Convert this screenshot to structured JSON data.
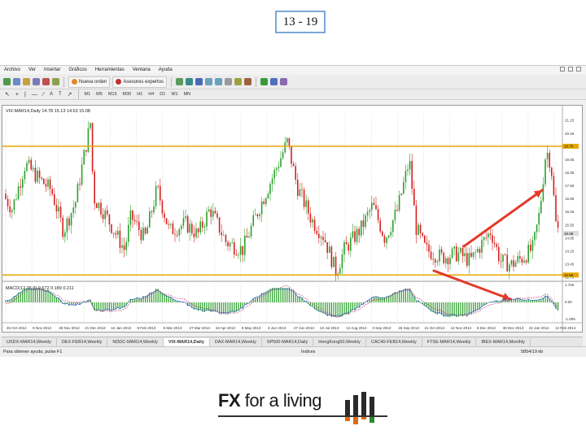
{
  "slide": {
    "number": "13 - 19"
  },
  "menu": [
    "Archivo",
    "Ver",
    "Insertar",
    "Gráficos",
    "Herramientas",
    "Ventana",
    "Ayuda"
  ],
  "toolbar": {
    "new_order": "Nueva orden",
    "expert_advisors": "Asesores expertos"
  },
  "timeframes": [
    "M1",
    "M5",
    "M15",
    "M30",
    "H1",
    "H4",
    "D1",
    "W1",
    "MN"
  ],
  "chart": {
    "header": "VIX-MAR14,Daily  14.78 15.13 14.63 15.08",
    "osc_header": "MACD(12,26,9)  0.672 0.189 0.211",
    "price_axis": [
      "21.15",
      "20.45",
      "19.75",
      "19.05",
      "18.35",
      "17.65",
      "16.95",
      "16.25",
      "15.55",
      "14.85",
      "14.15",
      "13.45",
      "12.75"
    ],
    "price_tag_upper": "19.75",
    "price_tag_current": "15.08",
    "price_tag_lower": "12.65",
    "osc_axis": [
      "1.726",
      "0.00",
      "-1.005"
    ],
    "dates": [
      "25 Oct 2012",
      "8 Nov 2012",
      "28 Nov 2012",
      "21 Dec 2012",
      "16 Jan 2013",
      "8 Feb 2013",
      "5 Mar 2013",
      "27 Mar 2013",
      "18 Apr 2013",
      "9 May 2013",
      "3 Jun 2013",
      "27 Jun 2013",
      "22 Jul 2013",
      "12 Aug 2013",
      "3 Sep 2013",
      "26 Sep 2013",
      "21 Oct 2013",
      "12 Nov 2013",
      "5 Dec 2013",
      "30 Dec 2013",
      "22 Jan 2014",
      "12 Feb 2014"
    ],
    "colors": {
      "bull": "#2ca02c",
      "bear": "#d42020",
      "level": "#e6a700",
      "arrow": "#e33a2a",
      "macd": "#1f4fd6",
      "signal": "#c03060"
    }
  },
  "tabs": [
    {
      "label": "USDX-MAR14,Weekly"
    },
    {
      "label": "DEX-FEB14,Weekly"
    },
    {
      "label": "NDDC-MAR14,Weekly"
    },
    {
      "label": "VIX-MAR14,Daily",
      "active": true
    },
    {
      "label": "DAX-MAR14,Weekly"
    },
    {
      "label": "SP500-MAR14,Daily"
    },
    {
      "label": "HongKong50,Weekly"
    },
    {
      "label": "CAC40-FEB14,Weekly"
    },
    {
      "label": "FTSE-MAR14,Weekly"
    },
    {
      "label": "IBEX-MAR14,Monthly"
    }
  ],
  "status": {
    "help": "Para obtener ayuda, pulse F1",
    "profile": "Índices",
    "traffic": "5854/19 kb"
  },
  "logo": {
    "fx": "FX",
    "rest": "for a living"
  }
}
